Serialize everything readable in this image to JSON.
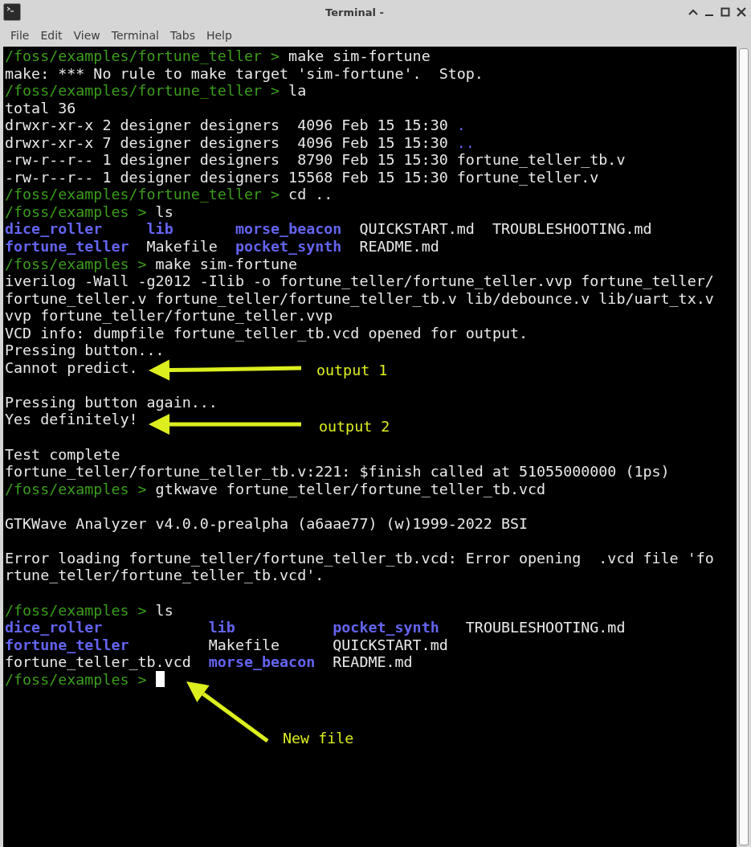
{
  "window": {
    "title": "Terminal -"
  },
  "menu": [
    "File",
    "Edit",
    "View",
    "Terminal",
    "Tabs",
    "Help"
  ],
  "terminal": {
    "lines": [
      {
        "kind": "text",
        "segments": [
          {
            "kind": "prompt",
            "text": "/foss/examples/fortune_teller > "
          },
          {
            "kind": "output",
            "text": "make sim-fortune"
          }
        ]
      },
      {
        "kind": "text",
        "segments": [
          {
            "kind": "output",
            "text": "make: *** No rule to make target 'sim-fortune'.  Stop."
          }
        ]
      },
      {
        "kind": "text",
        "segments": [
          {
            "kind": "prompt",
            "text": "/foss/examples/fortune_teller > "
          },
          {
            "kind": "output",
            "text": "la"
          }
        ]
      },
      {
        "kind": "text",
        "segments": [
          {
            "kind": "output",
            "text": "total 36"
          }
        ]
      },
      {
        "kind": "text",
        "segments": [
          {
            "kind": "output",
            "text": "drwxr-xr-x 2 designer designers  4096 Feb 15 15:30 "
          },
          {
            "kind": "link",
            "text": "."
          }
        ]
      },
      {
        "kind": "text",
        "segments": [
          {
            "kind": "output",
            "text": "drwxr-xr-x 7 designer designers  4096 Feb 15 15:30 "
          },
          {
            "kind": "link",
            "text": ".."
          }
        ]
      },
      {
        "kind": "text",
        "segments": [
          {
            "kind": "output",
            "text": "-rw-r--r-- 1 designer designers  8790 Feb 15 15:30 fortune_teller_tb.v"
          }
        ]
      },
      {
        "kind": "text",
        "segments": [
          {
            "kind": "output",
            "text": "-rw-r--r-- 1 designer designers 15568 Feb 15 15:30 fortune_teller.v"
          }
        ]
      },
      {
        "kind": "text",
        "segments": [
          {
            "kind": "prompt",
            "text": "/foss/examples/fortune_teller > "
          },
          {
            "kind": "output",
            "text": "cd .."
          }
        ]
      },
      {
        "kind": "text",
        "segments": [
          {
            "kind": "prompt",
            "text": "/foss/examples > "
          },
          {
            "kind": "output",
            "text": "ls"
          }
        ]
      },
      {
        "kind": "text",
        "segments": [
          {
            "kind": "folder",
            "text": "dice_roller     "
          },
          {
            "kind": "folder",
            "text": "lib       "
          },
          {
            "kind": "folder",
            "text": "morse_beacon"
          },
          {
            "kind": "output",
            "text": "  QUICKSTART.md  TROUBLESHOOTING.md"
          }
        ]
      },
      {
        "kind": "text",
        "segments": [
          {
            "kind": "folder",
            "text": "fortune_teller"
          },
          {
            "kind": "output",
            "text": "  Makefile  "
          },
          {
            "kind": "folder",
            "text": "pocket_synth"
          },
          {
            "kind": "output",
            "text": "  README.md"
          }
        ]
      },
      {
        "kind": "text",
        "segments": [
          {
            "kind": "prompt",
            "text": "/foss/examples > "
          },
          {
            "kind": "output",
            "text": "make sim-fortune"
          }
        ]
      },
      {
        "kind": "text",
        "segments": [
          {
            "kind": "output",
            "text": "iverilog -Wall -g2012 -Ilib -o fortune_teller/fortune_teller.vvp fortune_teller/"
          }
        ]
      },
      {
        "kind": "text",
        "segments": [
          {
            "kind": "output",
            "text": "fortune_teller.v fortune_teller/fortune_teller_tb.v lib/debounce.v lib/uart_tx.v"
          }
        ]
      },
      {
        "kind": "text",
        "segments": [
          {
            "kind": "output",
            "text": "vvp fortune_teller/fortune_teller.vvp"
          }
        ]
      },
      {
        "kind": "text",
        "segments": [
          {
            "kind": "output",
            "text": "VCD info: dumpfile fortune_teller_tb.vcd opened for output."
          }
        ]
      },
      {
        "kind": "text",
        "segments": [
          {
            "kind": "output",
            "text": "Pressing button..."
          }
        ]
      },
      {
        "kind": "text",
        "segments": [
          {
            "kind": "output",
            "text": "Cannot predict."
          }
        ]
      },
      {
        "kind": "blank"
      },
      {
        "kind": "text",
        "segments": [
          {
            "kind": "output",
            "text": "Pressing button again..."
          }
        ]
      },
      {
        "kind": "text",
        "segments": [
          {
            "kind": "output",
            "text": "Yes definitely!"
          }
        ]
      },
      {
        "kind": "blank"
      },
      {
        "kind": "text",
        "segments": [
          {
            "kind": "output",
            "text": "Test complete"
          }
        ]
      },
      {
        "kind": "text",
        "segments": [
          {
            "kind": "output",
            "text": "fortune_teller/fortune_teller_tb.v:221: $finish called at 51055000000 (1ps)"
          }
        ]
      },
      {
        "kind": "text",
        "segments": [
          {
            "kind": "prompt",
            "text": "/foss/examples > "
          },
          {
            "kind": "output",
            "text": "gtkwave fortune_teller/fortune_teller_tb.vcd"
          }
        ]
      },
      {
        "kind": "blank"
      },
      {
        "kind": "text",
        "segments": [
          {
            "kind": "output",
            "text": "GTKWave Analyzer v4.0.0-prealpha (a6aae77) (w)1999-2022 BSI"
          }
        ]
      },
      {
        "kind": "blank"
      },
      {
        "kind": "text",
        "segments": [
          {
            "kind": "output",
            "text": "Error loading fortune_teller/fortune_teller_tb.vcd: Error opening  .vcd file 'fo"
          }
        ]
      },
      {
        "kind": "text",
        "segments": [
          {
            "kind": "output",
            "text": "rtune_teller/fortune_teller_tb.vcd'."
          }
        ]
      },
      {
        "kind": "blank"
      },
      {
        "kind": "text",
        "segments": [
          {
            "kind": "prompt",
            "text": "/foss/examples > "
          },
          {
            "kind": "output",
            "text": "ls"
          }
        ]
      },
      {
        "kind": "text",
        "segments": [
          {
            "kind": "folder",
            "text": "dice_roller            "
          },
          {
            "kind": "folder",
            "text": "lib           "
          },
          {
            "kind": "folder",
            "text": "pocket_synth"
          },
          {
            "kind": "output",
            "text": "   TROUBLESHOOTING.md"
          }
        ]
      },
      {
        "kind": "text",
        "segments": [
          {
            "kind": "folder",
            "text": "fortune_teller"
          },
          {
            "kind": "output",
            "text": "         Makefile      QUICKSTART.md"
          }
        ]
      },
      {
        "kind": "text",
        "segments": [
          {
            "kind": "output",
            "text": "fortune_teller_tb.vcd  "
          },
          {
            "kind": "folder",
            "text": "morse_beacon"
          },
          {
            "kind": "output",
            "text": "  README.md"
          }
        ]
      },
      {
        "kind": "prompt",
        "segments": [
          {
            "kind": "prompt",
            "text": "/foss/examples > "
          }
        ]
      }
    ]
  },
  "annotations": [
    {
      "label": "output 1"
    },
    {
      "label": "output 2"
    },
    {
      "label": "New file"
    }
  ]
}
